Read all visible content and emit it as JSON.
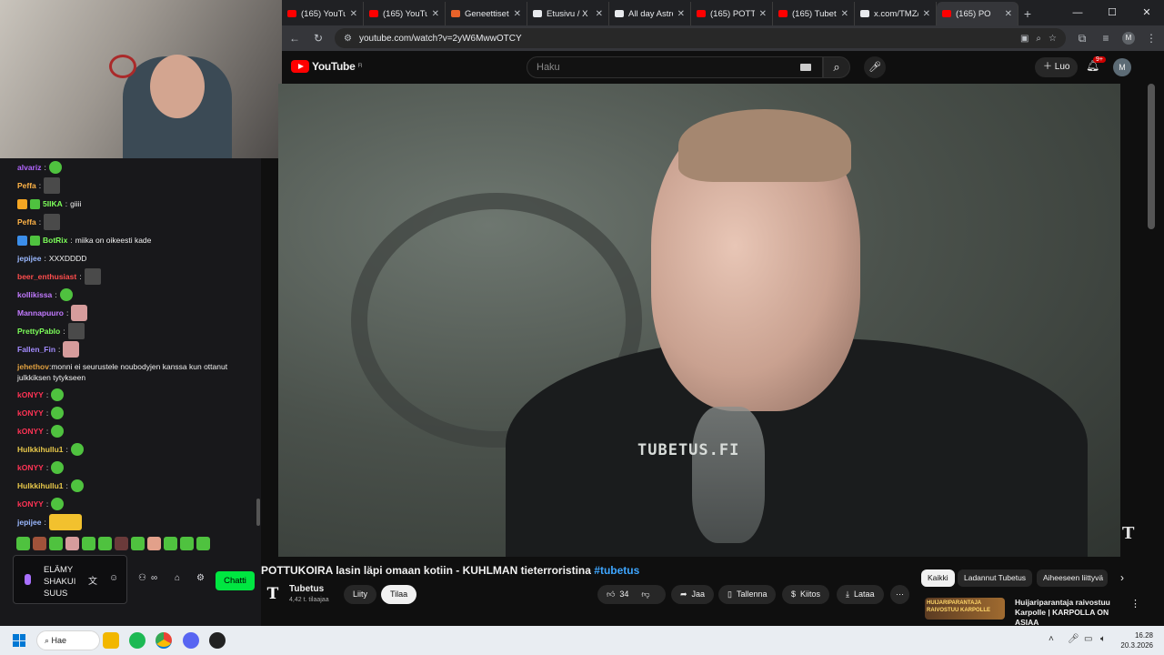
{
  "browser": {
    "tabs": [
      {
        "title": "(165) YouTub",
        "icon": "youtube-icon",
        "color": "#ff0000"
      },
      {
        "title": "(165) YouTub",
        "icon": "youtube-icon",
        "color": "#ff0000"
      },
      {
        "title": "Geneettiset",
        "icon": "site-icon",
        "color": "#e8632a"
      },
      {
        "title": "Etusivu / X",
        "icon": "x-icon",
        "color": "#e8eaed"
      },
      {
        "title": "All day Astro",
        "icon": "x-icon",
        "color": "#e8eaed"
      },
      {
        "title": "(165) POTTU",
        "icon": "youtube-icon",
        "color": "#ff0000"
      },
      {
        "title": "(165) Tubetu",
        "icon": "youtube-icon",
        "color": "#ff0000"
      },
      {
        "title": "x.com/TMZ/",
        "icon": "x-icon",
        "color": "#e8eaed"
      },
      {
        "title": "(165) PO",
        "icon": "youtube-icon",
        "color": "#ff0000",
        "active": true
      }
    ],
    "url": "youtube.com/watch?v=2yW6MwwOTCY",
    "profile_initial": "M"
  },
  "youtube": {
    "logo_text": "YouTube",
    "logo_region": "FI",
    "search_placeholder": "Haku",
    "create_label": "Luo",
    "notification_count": "9+",
    "avatar_initial": "M",
    "video": {
      "watermark": "TUBETUS.FI",
      "title": "POTTUKOIRA lasin läpi omaan kotiin - KUHLMAN tieterroristina",
      "hashtag": "#tubetus",
      "channel": "Tubetus",
      "subscribers": "4,42 t. tilaajaa",
      "join_label": "Liity",
      "subscribe_label": "Tilaa",
      "likes": "34",
      "share_label": "Jaa",
      "save_label": "Tallenna",
      "thanks_label": "Kiitos",
      "download_label": "Lataa"
    },
    "chips": [
      "Kaikki",
      "Ladannut Tubetus",
      "Aiheeseen liittyvä"
    ],
    "recommendation": {
      "thumb_text": "HUIJARIPARANTAJA RAIVOSTUU KARPOLLE",
      "title": "Huijariparantaja raivostuu Karpolle | KARPOLLA ON ASIAA"
    }
  },
  "chat": {
    "messages": [
      {
        "user": "alvariz",
        "color": "#b366ff",
        "text": "",
        "emote": "green"
      },
      {
        "user": "Peffa",
        "color": "#ffb347",
        "text": "",
        "emote": "sq"
      },
      {
        "user": "5IIKA",
        "color": "#7dff5a",
        "text": "giiii",
        "badges": [
          "#f5a623",
          "#4fc23f"
        ]
      },
      {
        "user": "Peffa",
        "color": "#ffb347",
        "text": "",
        "emote": "sq"
      },
      {
        "user": "BotRix",
        "color": "#7dff5a",
        "text": "miika on oikeesti kade",
        "badges": [
          "#3b8eea",
          "#4fc23f"
        ]
      },
      {
        "user": "jepijee",
        "color": "#9ab8ff",
        "text": "XXXDDDD"
      },
      {
        "user": "beer_enthusiast",
        "color": "#ff4d4d",
        "text": "",
        "emote": "sq"
      },
      {
        "user": "kollikissa",
        "color": "#c27aff",
        "text": "",
        "emote": "green"
      },
      {
        "user": "Mannapuuro",
        "color": "#c27aff",
        "text": "",
        "emote": "pink"
      },
      {
        "user": "PrettyPablo",
        "color": "#7dff5a",
        "text": "",
        "emote": "sq"
      },
      {
        "user": "Fallen_Fin",
        "color": "#a38bff",
        "text": "",
        "emote": "pink"
      },
      {
        "user": "jehethov",
        "color": "#e0a040",
        "text": "monni ei seurustele noubodyjen kanssa kun ottanut julkkiksen tytykseen",
        "tall": true
      },
      {
        "user": "kONYY",
        "color": "#ff3355",
        "text": "",
        "emote": "green"
      },
      {
        "user": "kONYY",
        "color": "#ff3355",
        "text": "",
        "emote": "green"
      },
      {
        "user": "kONYY",
        "color": "#ff3355",
        "text": "",
        "emote": "green"
      },
      {
        "user": "Hulkkihullu1",
        "color": "#e8c84a",
        "text": "",
        "emote": "green"
      },
      {
        "user": "kONYY",
        "color": "#ff3355",
        "text": "",
        "emote": "green"
      },
      {
        "user": "Hulkkihullu1",
        "color": "#e8c84a",
        "text": "",
        "emote": "green"
      },
      {
        "user": "kONYY",
        "color": "#ff3355",
        "text": "",
        "emote": "green"
      },
      {
        "user": "jepijee",
        "color": "#9ab8ff",
        "text": "",
        "emote": "yellow"
      }
    ],
    "emote_bar_colors": [
      "#4fc23f",
      "#a0523a",
      "#4fc23f",
      "#d69c9c",
      "#4fc23f",
      "#4fc23f",
      "#6a3a3a",
      "#4fc23f",
      "#e2a08a",
      "#4fc23f",
      "#4fc23f",
      "#4fc23f"
    ],
    "input_text": "ELÄMY SHAKUI SUUS",
    "send_label": "Chatti"
  },
  "taskbar": {
    "search_label": "Hae",
    "time": "16.28",
    "date": "20.3.2026"
  }
}
